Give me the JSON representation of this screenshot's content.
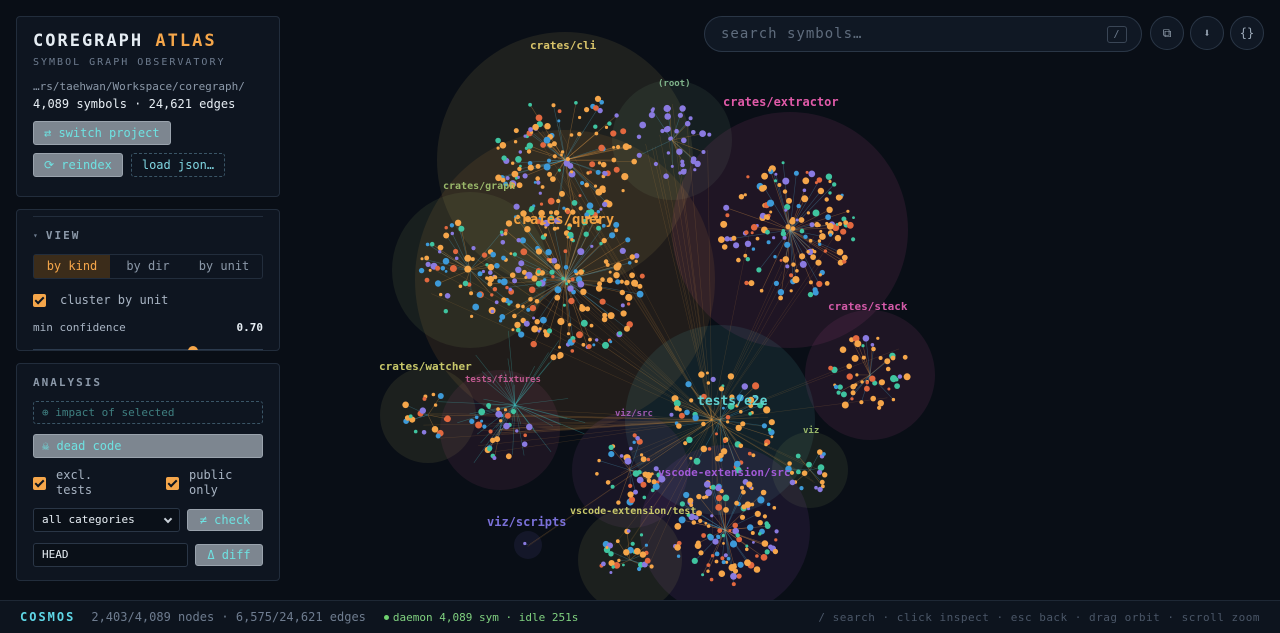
{
  "app": {
    "title_main": "COREGRAPH",
    "title_accent": "ATLAS",
    "subtitle": "SYMBOL GRAPH OBSERVATORY",
    "project_path": "…rs/taehwan/Workspace/coregraph/",
    "stats": "4,089 symbols · 24,621 edges",
    "switch_project": "⇄ switch project",
    "reindex": "⟳ reindex",
    "load_json": "load json…"
  },
  "view": {
    "title": "VIEW",
    "collapse_glyph": "▾",
    "modes": [
      "by kind",
      "by dir",
      "by unit"
    ],
    "active_mode": "by kind",
    "cluster_label": "cluster by unit",
    "cluster_checked": true,
    "confidence_label": "min confidence",
    "confidence_value": "0.70"
  },
  "analysis": {
    "title": "ANALYSIS",
    "impact": "⊕ impact of selected",
    "dead_code": "☠ dead code",
    "excl_tests": "excl. tests",
    "excl_tests_checked": true,
    "public_only": "public only",
    "public_only_checked": true,
    "category_value": "all categories",
    "check": "≠ check",
    "diff_ref": "HEAD",
    "diff": "Δ diff"
  },
  "search": {
    "placeholder": "search symbols…",
    "shortcut": "/"
  },
  "toolbar": {
    "icons": [
      "copy-icon",
      "download-icon",
      "json-icon"
    ],
    "copy_glyph": "⧉",
    "download_glyph": "⬇",
    "json_glyph": "{}"
  },
  "graph": {
    "clusters": [
      {
        "name": "crates/cli",
        "color": "#d9c46a"
      },
      {
        "name": "(root)",
        "color": "#7fb38a"
      },
      {
        "name": "crates/extractor",
        "color": "#e05aa8"
      },
      {
        "name": "crates/query",
        "color": "#f0a040"
      },
      {
        "name": "crates/graph",
        "color": "#9ab86a"
      },
      {
        "name": "crates/stack",
        "color": "#d45aa8"
      },
      {
        "name": "crates/watcher",
        "color": "#c8c86a"
      },
      {
        "name": "tests/fixtures",
        "color": "#c05a90"
      },
      {
        "name": "tests/e2e",
        "color": "#5fd0d0"
      },
      {
        "name": "viz/src",
        "color": "#a05ab0"
      },
      {
        "name": "viz",
        "color": "#9ab86a"
      },
      {
        "name": "vscode-extension/src",
        "color": "#a25ad8"
      },
      {
        "name": "vscode-extension/test",
        "color": "#c8c86a"
      },
      {
        "name": "viz/scripts",
        "color": "#7a70d8"
      }
    ]
  },
  "statusbar": {
    "brand": "COSMOS",
    "counts": "2,403/4,089 nodes · 6,575/24,621 edges",
    "daemon": "daemon 4,089 sym · idle 251s",
    "hints": "/ search · click inspect · esc back · drag orbit · scroll zoom"
  }
}
